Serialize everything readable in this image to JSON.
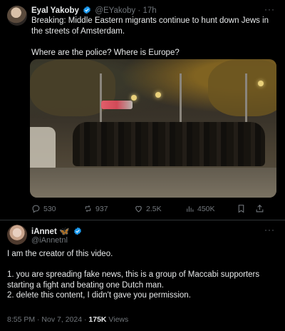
{
  "post1": {
    "name": "Eyal Yakoby",
    "handle": "@EYakoby",
    "separator": "·",
    "time": "17h",
    "more": "···",
    "text": "Breaking: Middle Eastern migrants continue to hunt down Jews in the streets of Amsterdam.\n\nWhere are the police? Where is Europe?",
    "media_icon": "video-thumbnail",
    "actions": {
      "replies": "530",
      "reposts": "937",
      "likes": "2.5K",
      "views": "450K"
    }
  },
  "post2": {
    "name": "iAnnet",
    "emoji": "🦋",
    "handle": "@iAnnetnl",
    "more": "···",
    "text": "I am the creator of this video.\n\n1. you are spreading fake news, this is a group of Maccabi supporters starting a fight and beating one Dutch man.\n2. delete this content, I didn't gave you permission.",
    "timestamp": "8:55 PM · Nov 7, 2024 · ",
    "views_count": "175K",
    "views_label": " Views"
  },
  "colors": {
    "background": "#000000",
    "text": "#e7e9ea",
    "muted": "#71767b",
    "verified": "#1d9bf0",
    "divider": "#2f3336"
  }
}
